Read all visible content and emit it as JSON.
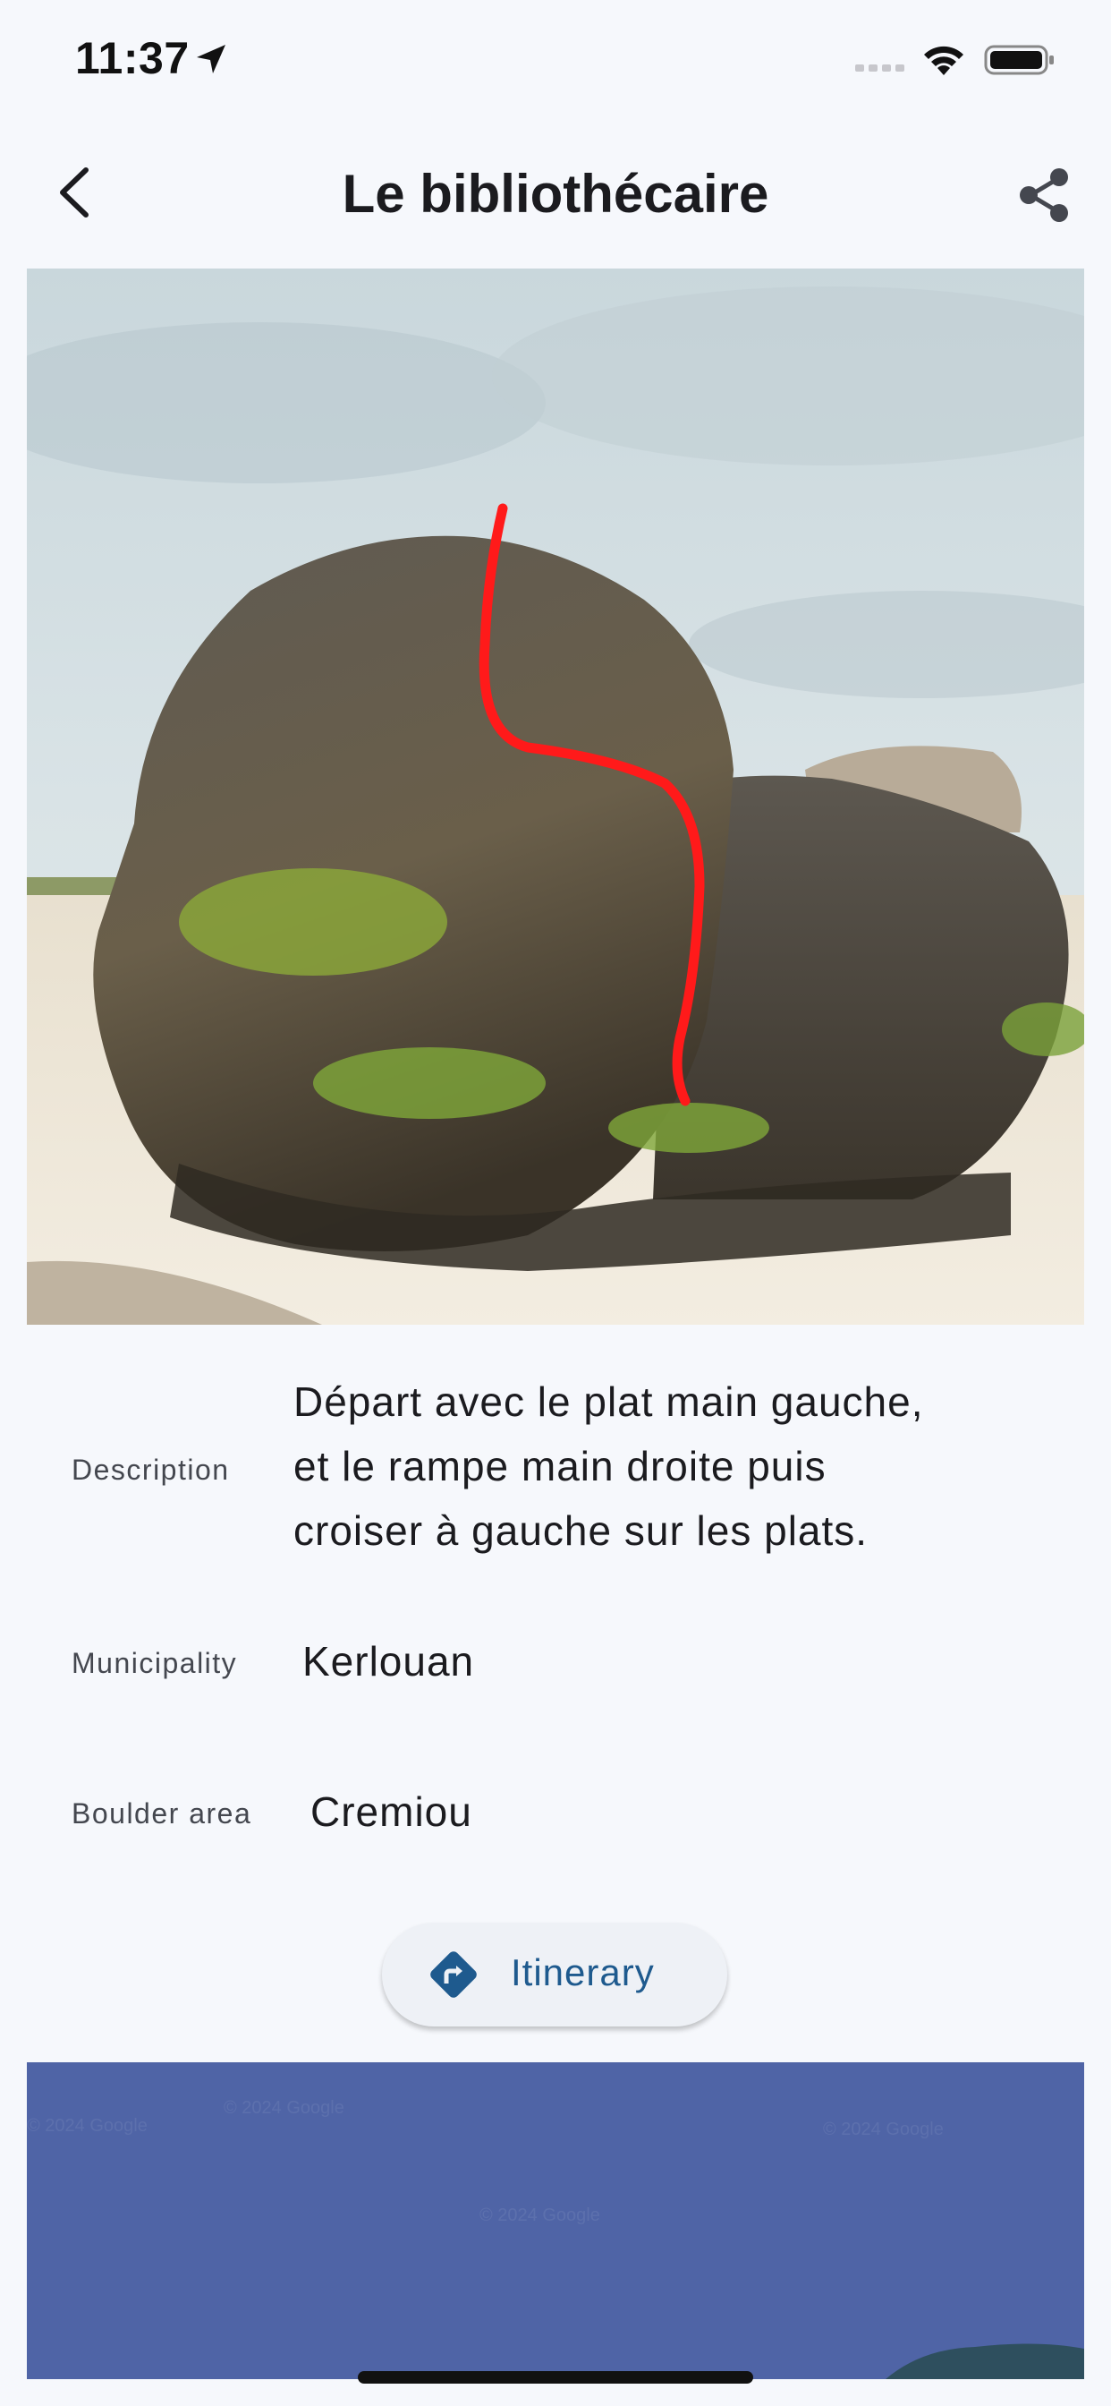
{
  "status_bar": {
    "time": "11:37",
    "icons": [
      "location-arrow-icon",
      "signal-icon",
      "wifi-icon",
      "battery-icon"
    ]
  },
  "header": {
    "title": "Le bibliothécaire",
    "back_icon": "chevron-left-icon",
    "share_icon": "share-icon"
  },
  "photo": {
    "subject": "boulder",
    "route_line_color": "#ff1a1a"
  },
  "details": {
    "description_label": "Description",
    "description_lines": [
      "Départ avec le plat main gauche,",
      "et le rampe main droite puis",
      "croiser à gauche sur les plats."
    ],
    "municipality_label": "Municipality",
    "municipality_value": "Kerlouan",
    "area_label": "Boulder area",
    "area_value": "Cremiou"
  },
  "itinerary_button": {
    "label": "Itinerary",
    "icon": "directions-icon"
  },
  "map": {
    "watermarks": [
      "© 2024 Google",
      "© 2024 Google",
      "© 2024 Google",
      "© 2024 Google"
    ]
  },
  "colors": {
    "background": "#f6f8fc",
    "accent": "#1e5a8e",
    "map_water": "#4f64a6"
  }
}
